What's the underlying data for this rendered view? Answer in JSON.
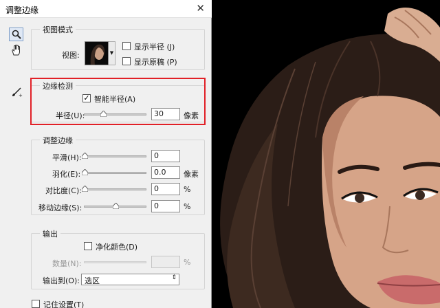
{
  "window": {
    "title": "调整边缘",
    "close_glyph": "✕"
  },
  "tools": [
    {
      "icon": "zoom-icon"
    },
    {
      "icon": "hand-icon"
    },
    {
      "icon": "refine-radius-brush-icon"
    }
  ],
  "view_mode": {
    "group_label": "视图模式",
    "view_label": "视图:",
    "show_radius": {
      "label": "显示半径 (J)",
      "checked": false
    },
    "show_original": {
      "label": "显示原稿 (P)",
      "checked": false
    }
  },
  "edge_detection": {
    "group_label": "边缘检测",
    "smart_radius": {
      "label": "智能半径(A)",
      "checked": true,
      "mark": "✓"
    },
    "radius": {
      "label": "半径(U):",
      "value": "30",
      "unit": "像素",
      "level": 0.3
    }
  },
  "adjust_edge": {
    "group_label": "调整边缘",
    "smooth": {
      "label": "平滑(H):",
      "value": "0",
      "unit": "",
      "level": 0
    },
    "feather": {
      "label": "羽化(E):",
      "value": "0.0",
      "unit": "像素",
      "level": 0
    },
    "contrast": {
      "label": "对比度(C):",
      "value": "0",
      "unit": "%",
      "level": 0
    },
    "shift_edge": {
      "label": "移动边缘(S):",
      "value": "0",
      "unit": "%",
      "level": 0.5
    }
  },
  "output": {
    "group_label": "输出",
    "decontaminate": {
      "label": "净化颜色(D)",
      "checked": false
    },
    "amount": {
      "label": "数量(N):",
      "value": "",
      "unit": "%",
      "disabled": true
    },
    "output_to": {
      "label": "输出到(O):",
      "selected": "选区",
      "arrow": "⇕"
    }
  },
  "remember": {
    "label": "记住设置(T)",
    "checked": false
  },
  "colors": {
    "highlight": "#e12027",
    "dialog_bg": "#f0f0f0"
  }
}
